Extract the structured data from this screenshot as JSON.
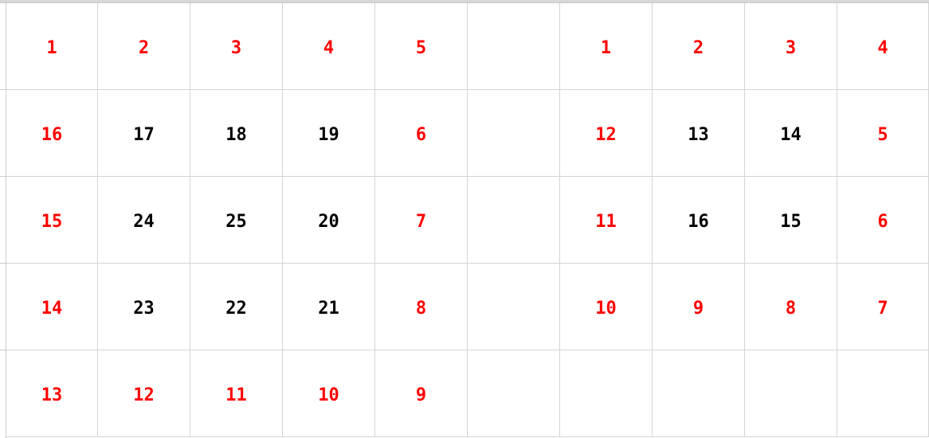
{
  "colors": {
    "highlight": "#ff0000",
    "normal": "#000000",
    "gridline": "#d4d4d4"
  },
  "sheet": {
    "rows": [
      [
        {
          "value": "1",
          "red": true
        },
        {
          "value": "2",
          "red": true
        },
        {
          "value": "3",
          "red": true
        },
        {
          "value": "4",
          "red": true
        },
        {
          "value": "5",
          "red": true
        },
        {
          "value": "",
          "red": false
        },
        {
          "value": "1",
          "red": true
        },
        {
          "value": "2",
          "red": true
        },
        {
          "value": "3",
          "red": true
        },
        {
          "value": "4",
          "red": true
        }
      ],
      [
        {
          "value": "16",
          "red": true
        },
        {
          "value": "17",
          "red": false
        },
        {
          "value": "18",
          "red": false
        },
        {
          "value": "19",
          "red": false
        },
        {
          "value": "6",
          "red": true
        },
        {
          "value": "",
          "red": false
        },
        {
          "value": "12",
          "red": true
        },
        {
          "value": "13",
          "red": false
        },
        {
          "value": "14",
          "red": false
        },
        {
          "value": "5",
          "red": true
        }
      ],
      [
        {
          "value": "15",
          "red": true
        },
        {
          "value": "24",
          "red": false
        },
        {
          "value": "25",
          "red": false
        },
        {
          "value": "20",
          "red": false
        },
        {
          "value": "7",
          "red": true
        },
        {
          "value": "",
          "red": false
        },
        {
          "value": "11",
          "red": true
        },
        {
          "value": "16",
          "red": false
        },
        {
          "value": "15",
          "red": false
        },
        {
          "value": "6",
          "red": true
        }
      ],
      [
        {
          "value": "14",
          "red": true
        },
        {
          "value": "23",
          "red": false
        },
        {
          "value": "22",
          "red": false
        },
        {
          "value": "21",
          "red": false
        },
        {
          "value": "8",
          "red": true
        },
        {
          "value": "",
          "red": false
        },
        {
          "value": "10",
          "red": true
        },
        {
          "value": "9",
          "red": true
        },
        {
          "value": "8",
          "red": true
        },
        {
          "value": "7",
          "red": true
        }
      ],
      [
        {
          "value": "13",
          "red": true
        },
        {
          "value": "12",
          "red": true
        },
        {
          "value": "11",
          "red": true
        },
        {
          "value": "10",
          "red": true
        },
        {
          "value": "9",
          "red": true
        },
        {
          "value": "",
          "red": false
        },
        {
          "value": "",
          "red": false
        },
        {
          "value": "",
          "red": false
        },
        {
          "value": "",
          "red": false
        },
        {
          "value": "",
          "red": false
        }
      ]
    ]
  }
}
